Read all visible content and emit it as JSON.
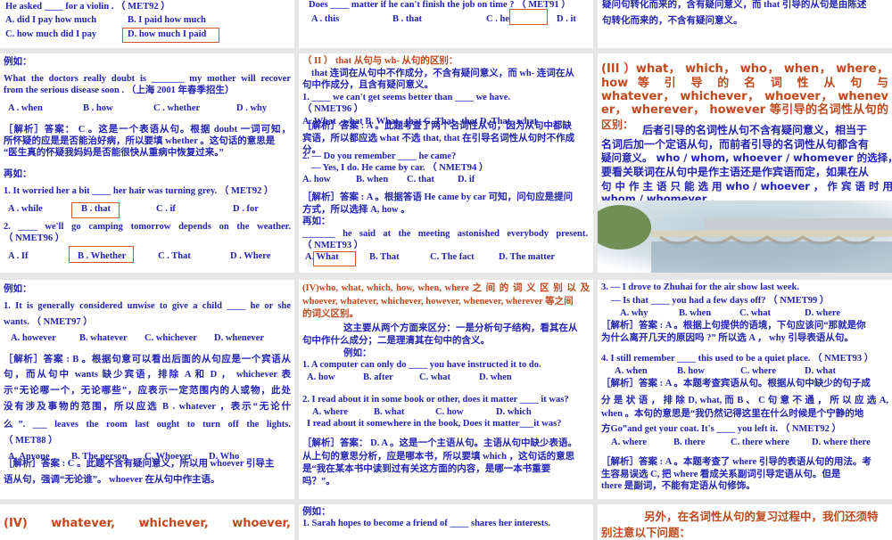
{
  "colors": {
    "text": "#2323b4",
    "heading": "#c0481c",
    "answer_box": "#d2542a"
  },
  "a1": [
    "He asked ____ for a violin . （ MET92 ）",
    "A. did I pay how much",
    "B. I paid how much",
    "C. how much did I pay",
    "D. how much I paid"
  ],
  "b1": [
    "Does ____ matter if he can't finish the job on time ? （ MET91 ）",
    "A .  this",
    "B .  that",
    "C .  he",
    "D .  it"
  ],
  "c1": [
    "疑问句转化而来的，含有疑问意义，而  that 引导的从句是由陈述",
    "句转化而来的，不含有疑问意义。"
  ],
  "a2": [
    "例如：",
    "What the doctors really doubt is _______ my mother will recover",
    "from the serious disease soon .  （上海 2001 年春季招生）",
    "A .  when",
    "B .  how",
    "C .  whether",
    "D .  why",
    "［解析］答案： C 。这是一个表语从句。根据  doubt  一词可知，",
    "所怀疑的应是是否能治好病，所以要填 whether 。这句话的意思是",
    "“医生真的怀疑我妈妈是否能很快从重病中恢复过来。”",
    "再如：",
    "1. It worried her a bit  ____ her hair was turning grey. （ MET92 ）",
    "A .  while",
    "B .  that",
    "C .  if",
    "D .  for",
    "2.  ____ we'll go camping tomorrow depends on the weather.",
    "（ NMET96 ）",
    "A .  If",
    "B .  Whether",
    "C .  That",
    "D .  Where"
  ],
  "b2": [
    "（ II ） that 从句与  wh- 从句的区别：",
    "that 连词在从句中不作成分，不含有疑问意义，而 wh- 连词在从",
    "句中作成分，且含有疑问意义。",
    "1.  ____ we can't get seems better than ____ we have.",
    "（ NMET96 ）",
    "A. What , what  B. What , that  C. That , that  D. That , what",
    "［解析］答案 : A 。此题考查了两个名词性从句，因为从句中都缺",
    "宾语，所以都应选 what 不选 that, that 在引导名词性从句时不作成",
    "分。",
    "2. — Do you remember ____ he came?",
    "— Yes, I do. He came by car.  （ NMET94 ）",
    "A. how",
    "B. when",
    "C. that",
    "D. if",
    "［解析］答案 : A 。根据答语 He came by car 可知，问句应是提问",
    "方式，所以选择 A, how 。",
    "再如：",
    "_______ he said at the meeting astonished everybody present.",
    "（ NMET93 ）",
    "A. What",
    "B. That",
    "C. The fact",
    "D. The matter"
  ],
  "c2": [
    "(III ）what， which， who， when， where，",
    "how 等 引 导 的 名 词 性 从 句 与",
    "whatever， whichever， whoever， whenev",
    "er， wherever， however 等引导的名词性从句的",
    "区别：",
    "后者引导的名词性从句不含有疑问意义，相当于",
    "名词后加一个定语从句，而前者引导的名词性从句都含有",
    "疑问意义。 who / whom, whoever / whomever 的选择，",
    "要看关联词在从句中是作主语还是作宾语而定，如果在从",
    "句 中 作 主 语 只 能 选 用   who / whoever ， 作 宾 语 时 用",
    "whom / whomever ."
  ],
  "a3": [
    "例如：",
    "1. It is generally considered unwise to give a child ____ he or she",
    "wants. （ NMET97 ）",
    "A. however",
    "B. whatever",
    "C. whichever",
    "D. whenever",
    "［解析］答案 : B 。根据句意可以看出后面的从句应是一个宾语从",
    "句，而从句中  wants 缺少宾语，排除  A 和  D ， whichever 表",
    "示“无论哪一个，无论哪些”，应表示一定范围内的人或物，此处",
    "没有涉及事物的范围，所以应选  B .  whatever ，表示“无论什",
    "么”.  ___  leaves the room last ought to turn off the lights.",
    "（ MET88 ）",
    "A. Anyone",
    "B. The person",
    "C. Whoever",
    "D. Who",
    "［解析］答案 : C 。此题不含有疑问意义，所以用 whoever 引导主",
    "语从句，强调“无论谁”。 whoever 在从句中作主语。"
  ],
  "b3": [
    "(IV)who, what, which, how, when, where 之 间 的 词 义 区 别 以 及",
    "whoever, whatever, whichever, however, whenever, wherever 等之间",
    "的词义区别。",
    "这主要从两个方面来区分：一是分析句子结构，看其在从",
    "句中作什么成分；二是理清其在句中的含义。",
    "例如：",
    "1. A computer can only do ____ you have instructed it to do.",
    "A. how",
    "B. after",
    "C. what",
    "D. when",
    "2. I read about it in some book or other, does it matter ____  it was?",
    "A. where",
    "B. what",
    "C. how",
    "D. which",
    "I read about it somewhere in the book, Does it matter___it was?",
    "［解析］答案： D. A 。这是一个主语从句。主语从句中缺少表语。",
    "从上句的意思分析，应是哪本书，所以要填 which ，这句话的意思",
    "是“我在某本书中读到过有关这方面的内容，是哪一本书重要",
    "吗？”。"
  ],
  "c3": [
    "3. — I drove to Zhuhai for the air show last week.",
    "— Is that ____  you had a few days off?  （ NMET99 ）",
    "A. why",
    "B. when",
    "C. what",
    "D. where",
    "［解析］答案 : A 。根据上句提供的语境，下句应该问“那就是你",
    "为什么离开几天的原因吗 ?” 所以选 A ， why 引导表语从句。",
    "4. I still remember ____ this used to be a quiet place. （ NMET93 ）",
    "A. when",
    "B. how",
    "C. where",
    "D. what",
    "［解析］答案 : A 。本题考查宾语从句。根据从句中缺少的句子成",
    "分 是 状 语 ， 排 除  D, what,  而  B 、 C  句 意 不 通 ， 所 以 应 选  A,",
    "when 。本句的意思是“我仍然记得这里在什么时候是个宁静的地",
    "方Go”and get your coat. It's ____ you left it.  （ NMET92 ）",
    "A. where",
    "B. there",
    "C. there where",
    "D. where there",
    "［解析］答案 : A 。本题考查了 where 引导的表语从句的用法。考",
    "生容易误选 C, 把  where 看成关系副词引导定语从句。但是",
    "there 是副词，不能有定语从句修饰。"
  ],
  "a4": [
    "(IV)  whatever,  whichever,  whoever,"
  ],
  "b4": [
    "例如：",
    "1. Sarah hopes to become a friend of ____ shares her interests."
  ],
  "c4": [
    "另外，在名词性从句的复习过程中，我们还须特",
    "别注意以下问题："
  ]
}
